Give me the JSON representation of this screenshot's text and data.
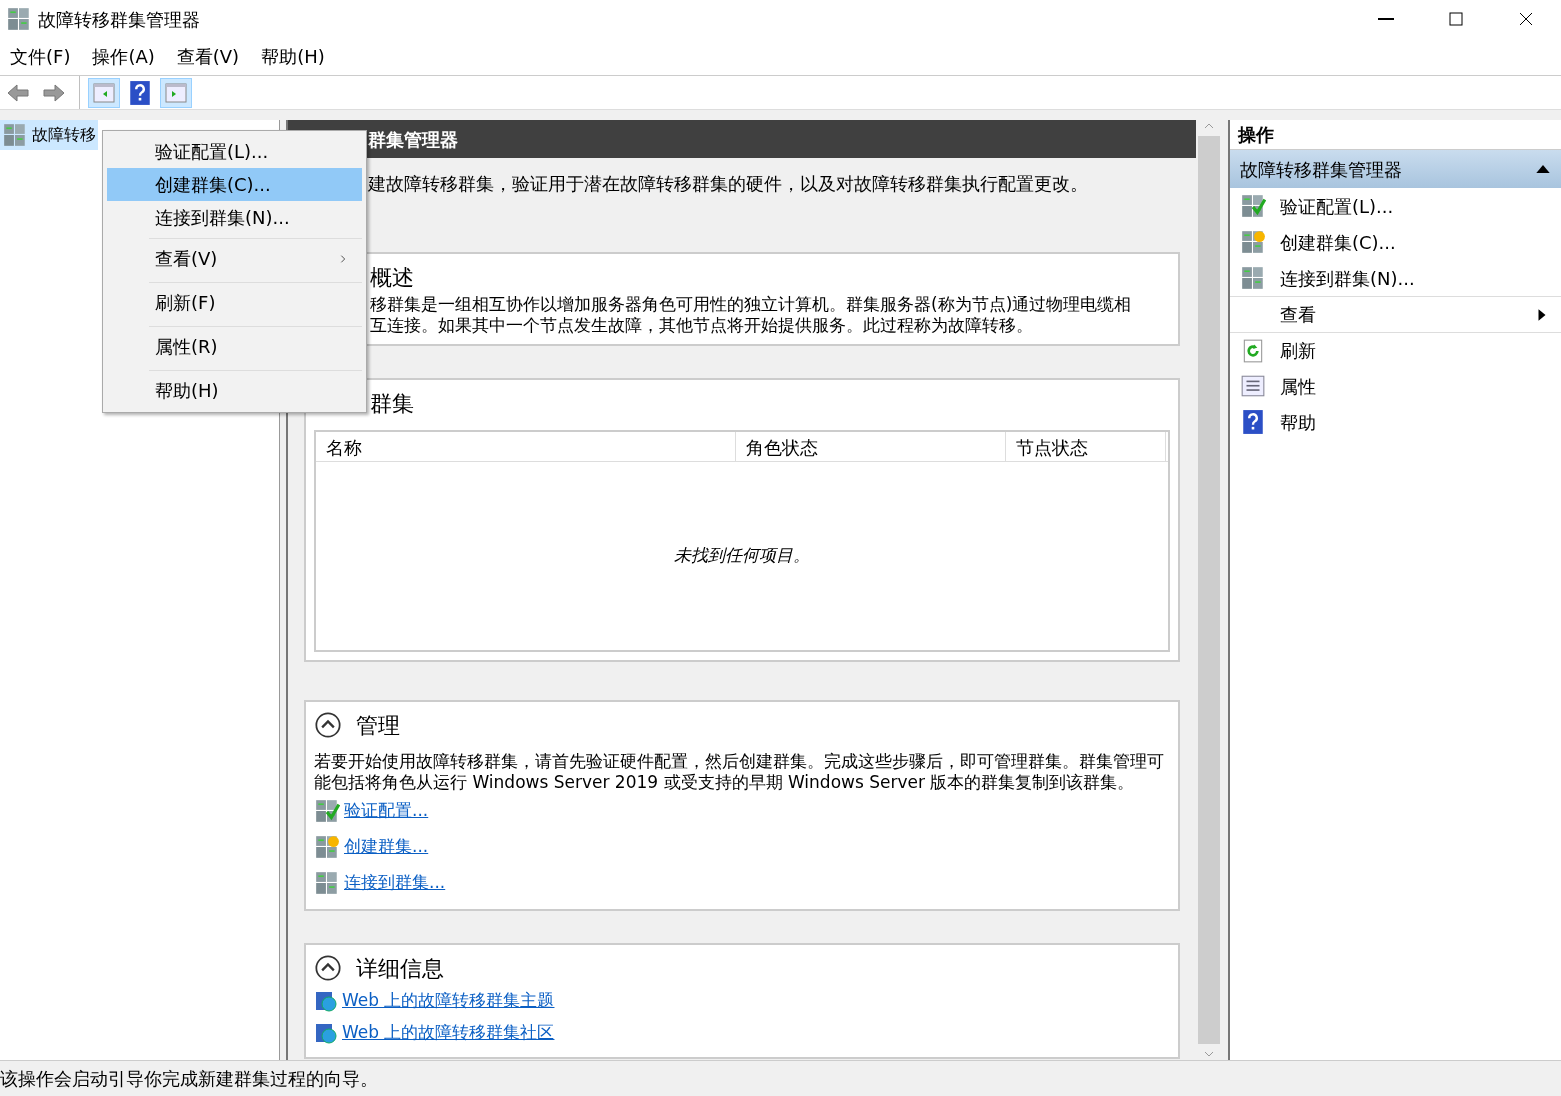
{
  "window": {
    "title": "故障转移群集管理器"
  },
  "menu_bar": [
    "文件(F)",
    "操作(A)",
    "查看(V)",
    "帮助(H)"
  ],
  "toolbar": [
    {
      "kind": "back",
      "pressed": false
    },
    {
      "kind": "forward",
      "pressed": false
    },
    {
      "kind": "tree",
      "pressed": true
    },
    {
      "kind": "help",
      "pressed": false
    },
    {
      "kind": "actions",
      "pressed": true
    }
  ],
  "tree": {
    "items": [
      {
        "label": "故障转移",
        "selected": true
      }
    ]
  },
  "context_menu": {
    "items": [
      {
        "label": "验证配置(L)...",
        "selected": false,
        "separator_before": false,
        "submenu": false
      },
      {
        "label": "创建群集(C)...",
        "selected": true,
        "separator_before": false,
        "submenu": false
      },
      {
        "label": "连接到群集(N)...",
        "selected": false,
        "separator_before": false,
        "submenu": false
      },
      {
        "label": "查看(V)",
        "selected": false,
        "separator_before": true,
        "submenu": true
      },
      {
        "label": "刷新(F)",
        "selected": false,
        "separator_before": true,
        "submenu": false
      },
      {
        "label": "属性(R)",
        "selected": false,
        "separator_before": true,
        "submenu": false
      },
      {
        "label": "帮助(H)",
        "selected": false,
        "separator_before": true,
        "submenu": false
      }
    ]
  },
  "center": {
    "header": "群集管理器",
    "description": "建故障转移群集，验证用于潜在故障转移群集的硬件，以及对故障转移群集执行配置更改。",
    "overview": {
      "title": "概述",
      "text": "移群集是一组相互协作以增加服务器角色可用性的独立计算机。群集服务器(称为节点)通过物理电缆相互连接。如果其中一个节点发生故障，其他节点将开始提供服务。此过程称为故障转移。"
    },
    "clusters": {
      "title": "群集",
      "columns": [
        "名称",
        "角色状态",
        "节点状态"
      ],
      "empty_message": "未找到任何项目。"
    },
    "manage": {
      "title": "管理",
      "expanded": true,
      "text": "若要开始使用故障转移群集，请首先验证硬件配置，然后创建群集。完成这些步骤后，即可管理群集。群集管理可能包括将角色从运行 Windows Server 2019 或受支持的早期 Windows Server 版本的群集复制到该群集。",
      "links": [
        {
          "kind": "validate",
          "label": "验证配置..."
        },
        {
          "kind": "create",
          "label": "创建群集..."
        },
        {
          "kind": "connect",
          "label": "连接到群集..."
        }
      ]
    },
    "details": {
      "title": "详细信息",
      "expanded": true,
      "links": [
        {
          "label": "Web 上的故障转移群集主题"
        },
        {
          "label": "Web 上的故障转移群集社区"
        }
      ]
    }
  },
  "actions": {
    "title": "操作",
    "group": {
      "label": "故障转移群集管理器",
      "expanded": true
    },
    "items": [
      {
        "kind": "validate",
        "label": "验证配置(L)...",
        "submenu": false
      },
      {
        "kind": "create",
        "label": "创建群集(C)...",
        "submenu": false
      },
      {
        "kind": "connect",
        "label": "连接到群集(N)...",
        "submenu": false
      },
      {
        "kind": "none",
        "label": "查看",
        "submenu": true
      },
      {
        "kind": "refresh",
        "label": "刷新",
        "submenu": false
      },
      {
        "kind": "properties",
        "label": "属性",
        "submenu": false
      },
      {
        "kind": "help",
        "label": "帮助",
        "submenu": false
      }
    ]
  },
  "status_bar": {
    "text": "该操作会启动引导你完成新建群集过程的向导。"
  }
}
